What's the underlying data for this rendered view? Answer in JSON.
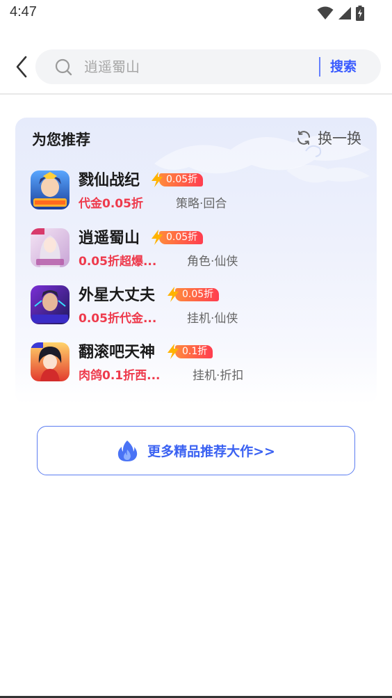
{
  "status_bar": {
    "time": "4:47",
    "icons": [
      "wifi-icon",
      "signal-icon",
      "battery-charging-icon"
    ]
  },
  "search": {
    "query": "逍遥蜀山",
    "button_label": "搜索",
    "accent": "#3a5bff"
  },
  "recommend": {
    "title": "为您推荐",
    "refresh_label": "换一换",
    "games": [
      {
        "name": "戮仙战纪",
        "tag": "0.05折",
        "promo": "代金0.05折",
        "genre": "策略·回合"
      },
      {
        "name": "逍遥蜀山",
        "tag": "0.05折",
        "promo": "0.05折超爆...",
        "genre": "角色·仙侠"
      },
      {
        "name": "外星大丈夫",
        "tag": "0.05折",
        "promo": "0.05折代金...",
        "genre": "挂机·仙侠"
      },
      {
        "name": "翻滚吧天神",
        "tag": "0.1折",
        "promo": "肉鸽0.1折西...",
        "genre": "挂机·折扣"
      }
    ]
  },
  "more_button": {
    "label": "更多精品推荐大作>>"
  },
  "colors": {
    "promo_red": "#ee3a4c",
    "tag_gradient_start": "#ff8a3c",
    "tag_gradient_end": "#ff3d4f",
    "card_bg": "#e6ebfb"
  }
}
